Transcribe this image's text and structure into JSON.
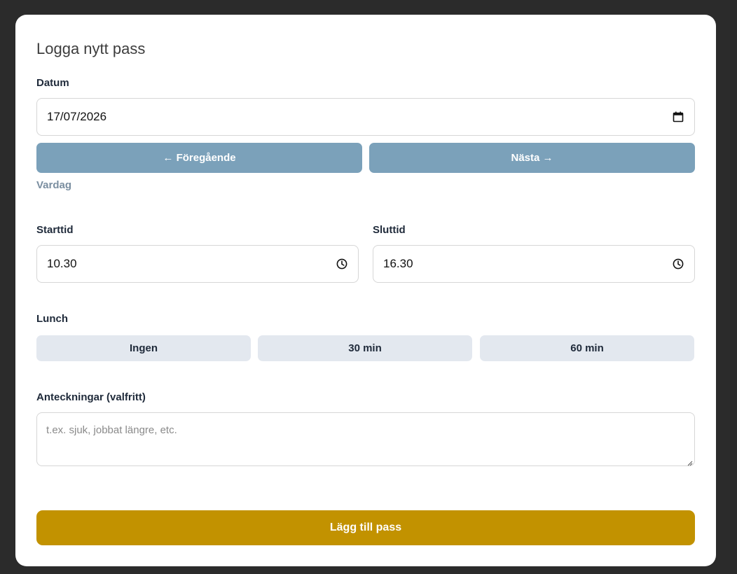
{
  "form": {
    "title": "Logga nytt pass",
    "date_label": "Datum",
    "date_value": "17/07/2026",
    "prev_label": "← Föregående",
    "next_label": "Nästa →",
    "day_type": "Vardag",
    "start_label": "Starttid",
    "start_value": "10.30",
    "end_label": "Sluttid",
    "end_value": "16.30",
    "lunch_label": "Lunch",
    "lunch_options": [
      "Ingen",
      "30 min",
      "60 min"
    ],
    "notes_label": "Anteckningar (valfritt)",
    "notes_placeholder": "t.ex. sjuk, jobbat längre, etc.",
    "submit_label": "Lägg till pass"
  },
  "colors": {
    "background": "#2b2b2b",
    "nav_button": "#7ba1ba",
    "lunch_button": "#e3e8ef",
    "submit_button": "#c29200"
  },
  "icons": {
    "date": "calendar-icon",
    "time": "clock-icon"
  }
}
